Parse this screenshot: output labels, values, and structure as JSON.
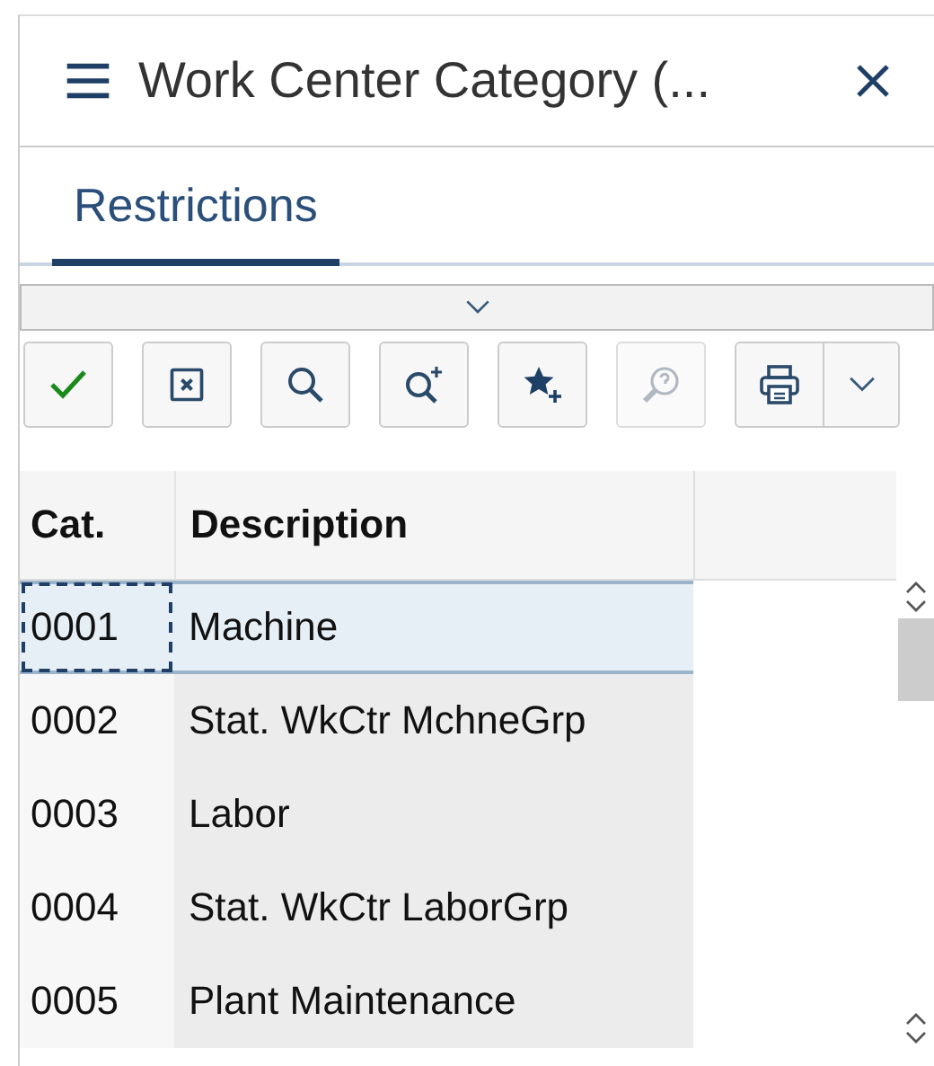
{
  "window": {
    "title": "Work Center Category (..."
  },
  "tabs": [
    {
      "label": "Restrictions",
      "selected": true
    }
  ],
  "toolbar": [
    {
      "kind": "confirm",
      "disabled": false,
      "dropdown": false
    },
    {
      "kind": "cancel",
      "disabled": false,
      "dropdown": false
    },
    {
      "kind": "search",
      "disabled": false,
      "dropdown": false
    },
    {
      "kind": "search-more",
      "disabled": false,
      "dropdown": false
    },
    {
      "kind": "favorite-add",
      "disabled": false,
      "dropdown": false
    },
    {
      "kind": "help",
      "disabled": true,
      "dropdown": false
    },
    {
      "kind": "print",
      "disabled": false,
      "dropdown": true
    }
  ],
  "table": {
    "columns": [
      "Cat.",
      "Description"
    ],
    "rows": [
      {
        "cells": [
          "0001",
          "Machine"
        ],
        "selected": true
      },
      {
        "cells": [
          "0002",
          "Stat. WkCtr MchneGrp"
        ],
        "selected": false
      },
      {
        "cells": [
          "0003",
          "Labor"
        ],
        "selected": false
      },
      {
        "cells": [
          "0004",
          "Stat. WkCtr LaborGrp"
        ],
        "selected": false
      },
      {
        "cells": [
          "0005",
          "Plant Maintenance"
        ],
        "selected": false
      }
    ]
  }
}
